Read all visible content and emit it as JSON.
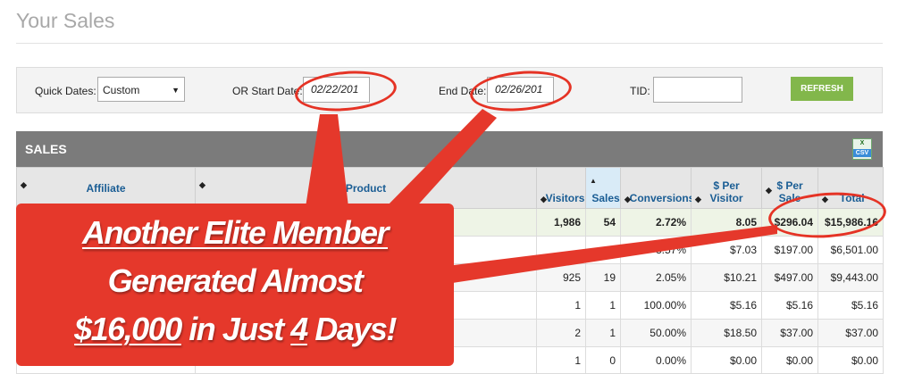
{
  "page": {
    "title": "Your Sales"
  },
  "filters": {
    "quick_dates_label": "Quick Dates:",
    "quick_dates_value": "Custom",
    "or_start_label": "OR  Start Date:",
    "start_date": "02/22/201",
    "end_date_label": "End Date:",
    "end_date": "02/26/201",
    "tid_label": "TID:",
    "tid_value": "",
    "refresh": "REFRESH"
  },
  "sales": {
    "title": "SALES",
    "csv_icon": "excel-csv-icon",
    "csv_label_x": "X",
    "csv_label": "CSV",
    "columns": {
      "affiliate": "Affiliate",
      "product": "Product",
      "visitors": "Visitors",
      "sales": "Sales",
      "conversions": "Conversions",
      "per_visitor_1": "$ Per",
      "per_visitor_2": "Visitor",
      "per_sale_1": "$ Per",
      "per_sale_2": "Sale",
      "total": "Total"
    },
    "rows": [
      {
        "visitors": "1,986",
        "sales": "54",
        "conversions": "2.72%",
        "per_visitor": "8.05",
        "per_sale": "$296.04",
        "total": "$15,986.16"
      },
      {
        "visitors": "",
        "sales": "",
        "conversions": "3.57%",
        "per_visitor": "$7.03",
        "per_sale": "$197.00",
        "total": "$6,501.00"
      },
      {
        "visitors": "925",
        "sales": "19",
        "conversions": "2.05%",
        "per_visitor": "$10.21",
        "per_sale": "$497.00",
        "total": "$9,443.00"
      },
      {
        "visitors": "1",
        "sales": "1",
        "conversions": "100.00%",
        "per_visitor": "$5.16",
        "per_sale": "$5.16",
        "total": "$5.16"
      },
      {
        "visitors": "2",
        "sales": "1",
        "conversions": "50.00%",
        "per_visitor": "$18.50",
        "per_sale": "$37.00",
        "total": "$37.00"
      },
      {
        "visitors": "1",
        "sales": "0",
        "conversions": "0.00%",
        "per_visitor": "$0.00",
        "per_sale": "$0.00",
        "total": "$0.00"
      }
    ]
  },
  "banner": {
    "line1": "Another Elite Member",
    "line2": "Generated Almost",
    "line3_amount": "$16,000",
    "line3_mid": " in Just ",
    "line3_num": "4",
    "line3_end": " Days!"
  },
  "colors": {
    "annotation_red": "#e5382b",
    "refresh_green": "#82b74b",
    "header_gray": "#7b7b7b",
    "link_blue": "#1a5d94"
  }
}
